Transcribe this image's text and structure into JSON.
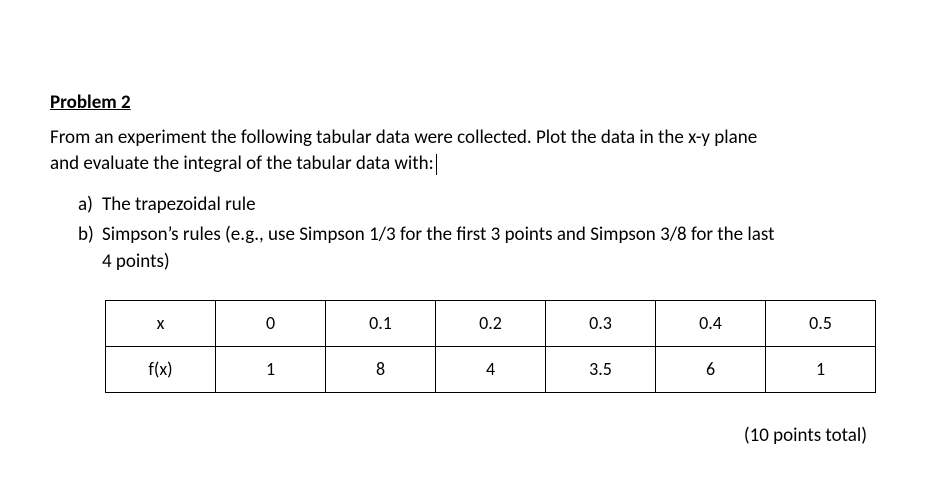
{
  "heading": "Problem 2",
  "intro_line1": "From an experiment the following tabular data were collected. Plot the data in the x-y plane",
  "intro_line2": "and evaluate the integral of the tabular data with:",
  "items": {
    "a": {
      "marker": "a)",
      "text": "The trapezoidal rule"
    },
    "b": {
      "marker": "b)",
      "line1": "Simpson’s rules (e.g., use Simpson 1/3 for the first 3 points and Simpson 3/8 for the last",
      "line2": "4 points)"
    }
  },
  "table": {
    "row_labels": {
      "x": "x",
      "fx": "f(x)"
    },
    "x": [
      "0",
      "0.1",
      "0.2",
      "0.3",
      "0.4",
      "0.5"
    ],
    "fx": [
      "1",
      "8",
      "4",
      "3.5",
      "6",
      "1"
    ]
  },
  "points_total": "(10 points total)",
  "chart_data": {
    "type": "table",
    "title": "Tabular experimental data",
    "columns": [
      "x",
      "f(x)"
    ],
    "rows": [
      [
        0,
        1
      ],
      [
        0.1,
        8
      ],
      [
        0.2,
        4
      ],
      [
        0.3,
        3.5
      ],
      [
        0.4,
        6
      ],
      [
        0.5,
        1
      ]
    ]
  }
}
